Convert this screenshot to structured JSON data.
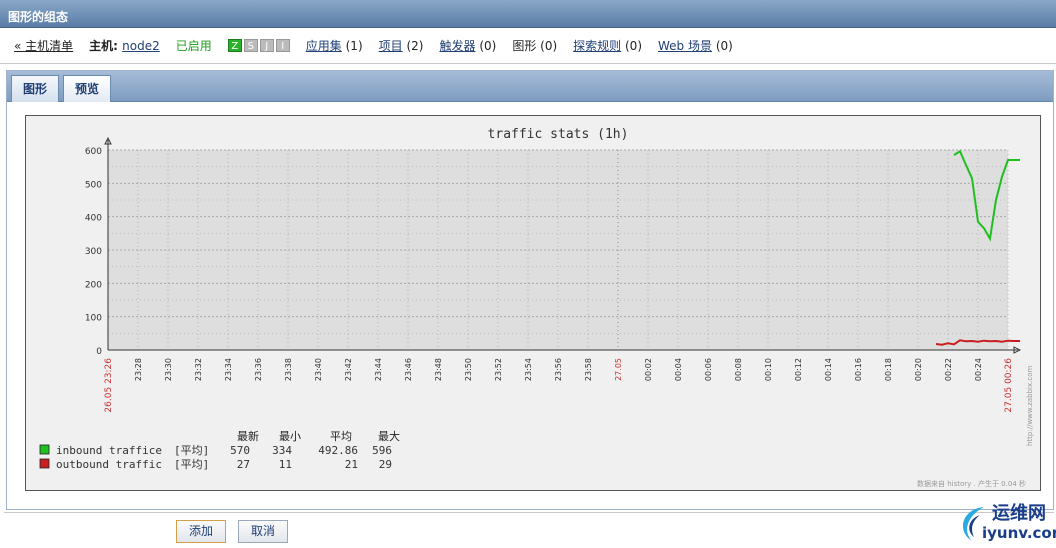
{
  "titlebar": {
    "title": "图形的组态"
  },
  "nav": {
    "back_label": "« 主机清单",
    "host_prefix": "主机:",
    "host_name": "node2",
    "status": "已启用",
    "availability": [
      "Z",
      "S",
      "J",
      "I"
    ],
    "links": [
      {
        "label": "应用集",
        "count": "(1)"
      },
      {
        "label": "项目",
        "count": "(2)"
      },
      {
        "label": "触发器",
        "count": "(0)"
      },
      {
        "label": "图形",
        "count": "(0)",
        "current": true
      },
      {
        "label": "探索规则",
        "count": "(0)"
      },
      {
        "label": "Web 场景",
        "count": "(0)"
      }
    ]
  },
  "tabs": [
    {
      "label": "图形",
      "active": false
    },
    {
      "label": "预览",
      "active": true
    }
  ],
  "chart_data": {
    "type": "line",
    "title": "traffic stats (1h)",
    "ylim": [
      0,
      600
    ],
    "yticks": [
      "0",
      "100",
      "200",
      "300",
      "400",
      "500",
      "600"
    ],
    "xticks": [
      "23:26",
      "23:28",
      "23:30",
      "23:32",
      "23:34",
      "23:36",
      "23:38",
      "23:40",
      "23:42",
      "23:44",
      "23:46",
      "23:48",
      "23:50",
      "23:52",
      "23:54",
      "23:56",
      "23:58",
      "27.05",
      "00:02",
      "00:04",
      "00:06",
      "00:08",
      "00:10",
      "00:12",
      "00:14",
      "00:16",
      "00:18",
      "00:20",
      "00:22",
      "00:24",
      "00:26"
    ],
    "start_label": "26.05 23:26",
    "end_label": "27.05 00:26",
    "grid": true,
    "series": [
      {
        "name": "inbound traffice",
        "color": "#1fbf1f",
        "x": [
          28.2,
          28.4,
          28.6,
          28.8,
          29.0,
          29.2,
          29.4,
          29.6,
          29.8,
          30.0,
          30.2,
          30.4
        ],
        "values": [
          585,
          596,
          555,
          515,
          385,
          365,
          334,
          450,
          520,
          570,
          570,
          570
        ]
      },
      {
        "name": "outbound traffic",
        "color": "#c81e1e",
        "x": [
          27.6,
          27.8,
          28.0,
          28.2,
          28.4,
          28.6,
          28.8,
          29.0,
          29.2,
          29.4,
          29.6,
          29.8,
          30.0,
          30.2,
          30.4
        ],
        "values": [
          18,
          16,
          20,
          17,
          29,
          26,
          27,
          25,
          28,
          26,
          27,
          25,
          28,
          27,
          27
        ]
      }
    ],
    "legend": {
      "headers": [
        "最新",
        "最小",
        "平均",
        "最大"
      ],
      "func_label": "[平均]",
      "rows": [
        {
          "name": "inbound traffice",
          "last": "570",
          "min": "334",
          "avg": "492.86",
          "max": "596"
        },
        {
          "name": "outbound traffic",
          "last": "27",
          "min": "11",
          "avg": "21",
          "max": "29"
        }
      ]
    },
    "footer_note": "数据来自 history . 产生于 0.04 秒",
    "side_note": "http://www.zabbix.com"
  },
  "buttons": {
    "add": "添加",
    "cancel": "取消"
  },
  "watermark": {
    "top": "运维网",
    "bottom": "iyunv.com"
  }
}
